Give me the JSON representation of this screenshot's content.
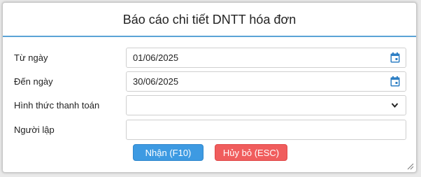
{
  "dialog": {
    "title": "Báo cáo chi tiết DNTT hóa đơn"
  },
  "form": {
    "from_date": {
      "label": "Từ ngày",
      "value": "01/06/2025",
      "icon": "calendar-icon"
    },
    "to_date": {
      "label": "Đến ngày",
      "value": "30/06/2025",
      "icon": "calendar-icon"
    },
    "payment_method": {
      "label": "Hình thức thanh toán",
      "value": "",
      "icon": "chevron-down-icon"
    },
    "creator": {
      "label": "Người lập",
      "value": ""
    }
  },
  "buttons": {
    "submit_label": "Nhận (F10)",
    "cancel_label": "Hủy bỏ (ESC)"
  },
  "colors": {
    "accent": "#3d9ae2",
    "danger": "#f05d5d",
    "header_rule": "#5aa3d6"
  }
}
